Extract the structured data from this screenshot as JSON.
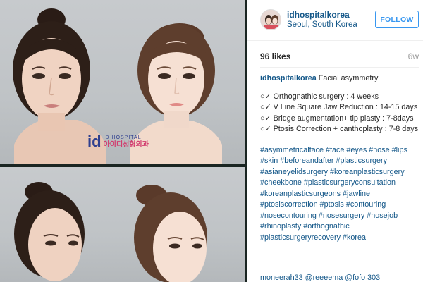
{
  "post": {
    "photo_description": "",
    "watermark": {
      "logo": "id",
      "brand_en": "ID HOSPITAL",
      "brand_kr": "아이디성형외과"
    }
  },
  "header": {
    "username": "idhospitalkorea",
    "location": "Seoul, South Korea",
    "follow_label": "FOLLOW"
  },
  "stats": {
    "likes": "96 likes",
    "time": "6w"
  },
  "caption": {
    "username": "idhospitalkorea",
    "title": "Facial asymmetry",
    "lines": [
      "○✓ Orthognathic surgery : 4 weeks",
      "○✓ V Line Square Jaw Reduction : 14-15 days",
      "○✓ Bridge augmentation+ tip plasty : 7-8days",
      "○✓ Ptosis Correction + canthoplasty : 7-8 days"
    ],
    "hashtags": "#asymmetricalface #face #eyes #nose #lips #skin #beforeandafter #plasticsurgery #asianeyelidsurgery #koreanplasticsurgery #cheekbone #plasticsurgeryconsultation #koreanplasticsurgeons #jawline #ptosiscorrection #ptosis #contouring #nosecontouring #nosesurgery #nosejob #rhinoplasty #orthognathic #plasticsurgeryrecovery #korea"
  },
  "comment": {
    "text": "moneerah33 @reeeema @fofo 303"
  },
  "colors": {
    "link": "#125688",
    "follow": "#3897f0",
    "text": "#262626",
    "muted": "#999999"
  }
}
